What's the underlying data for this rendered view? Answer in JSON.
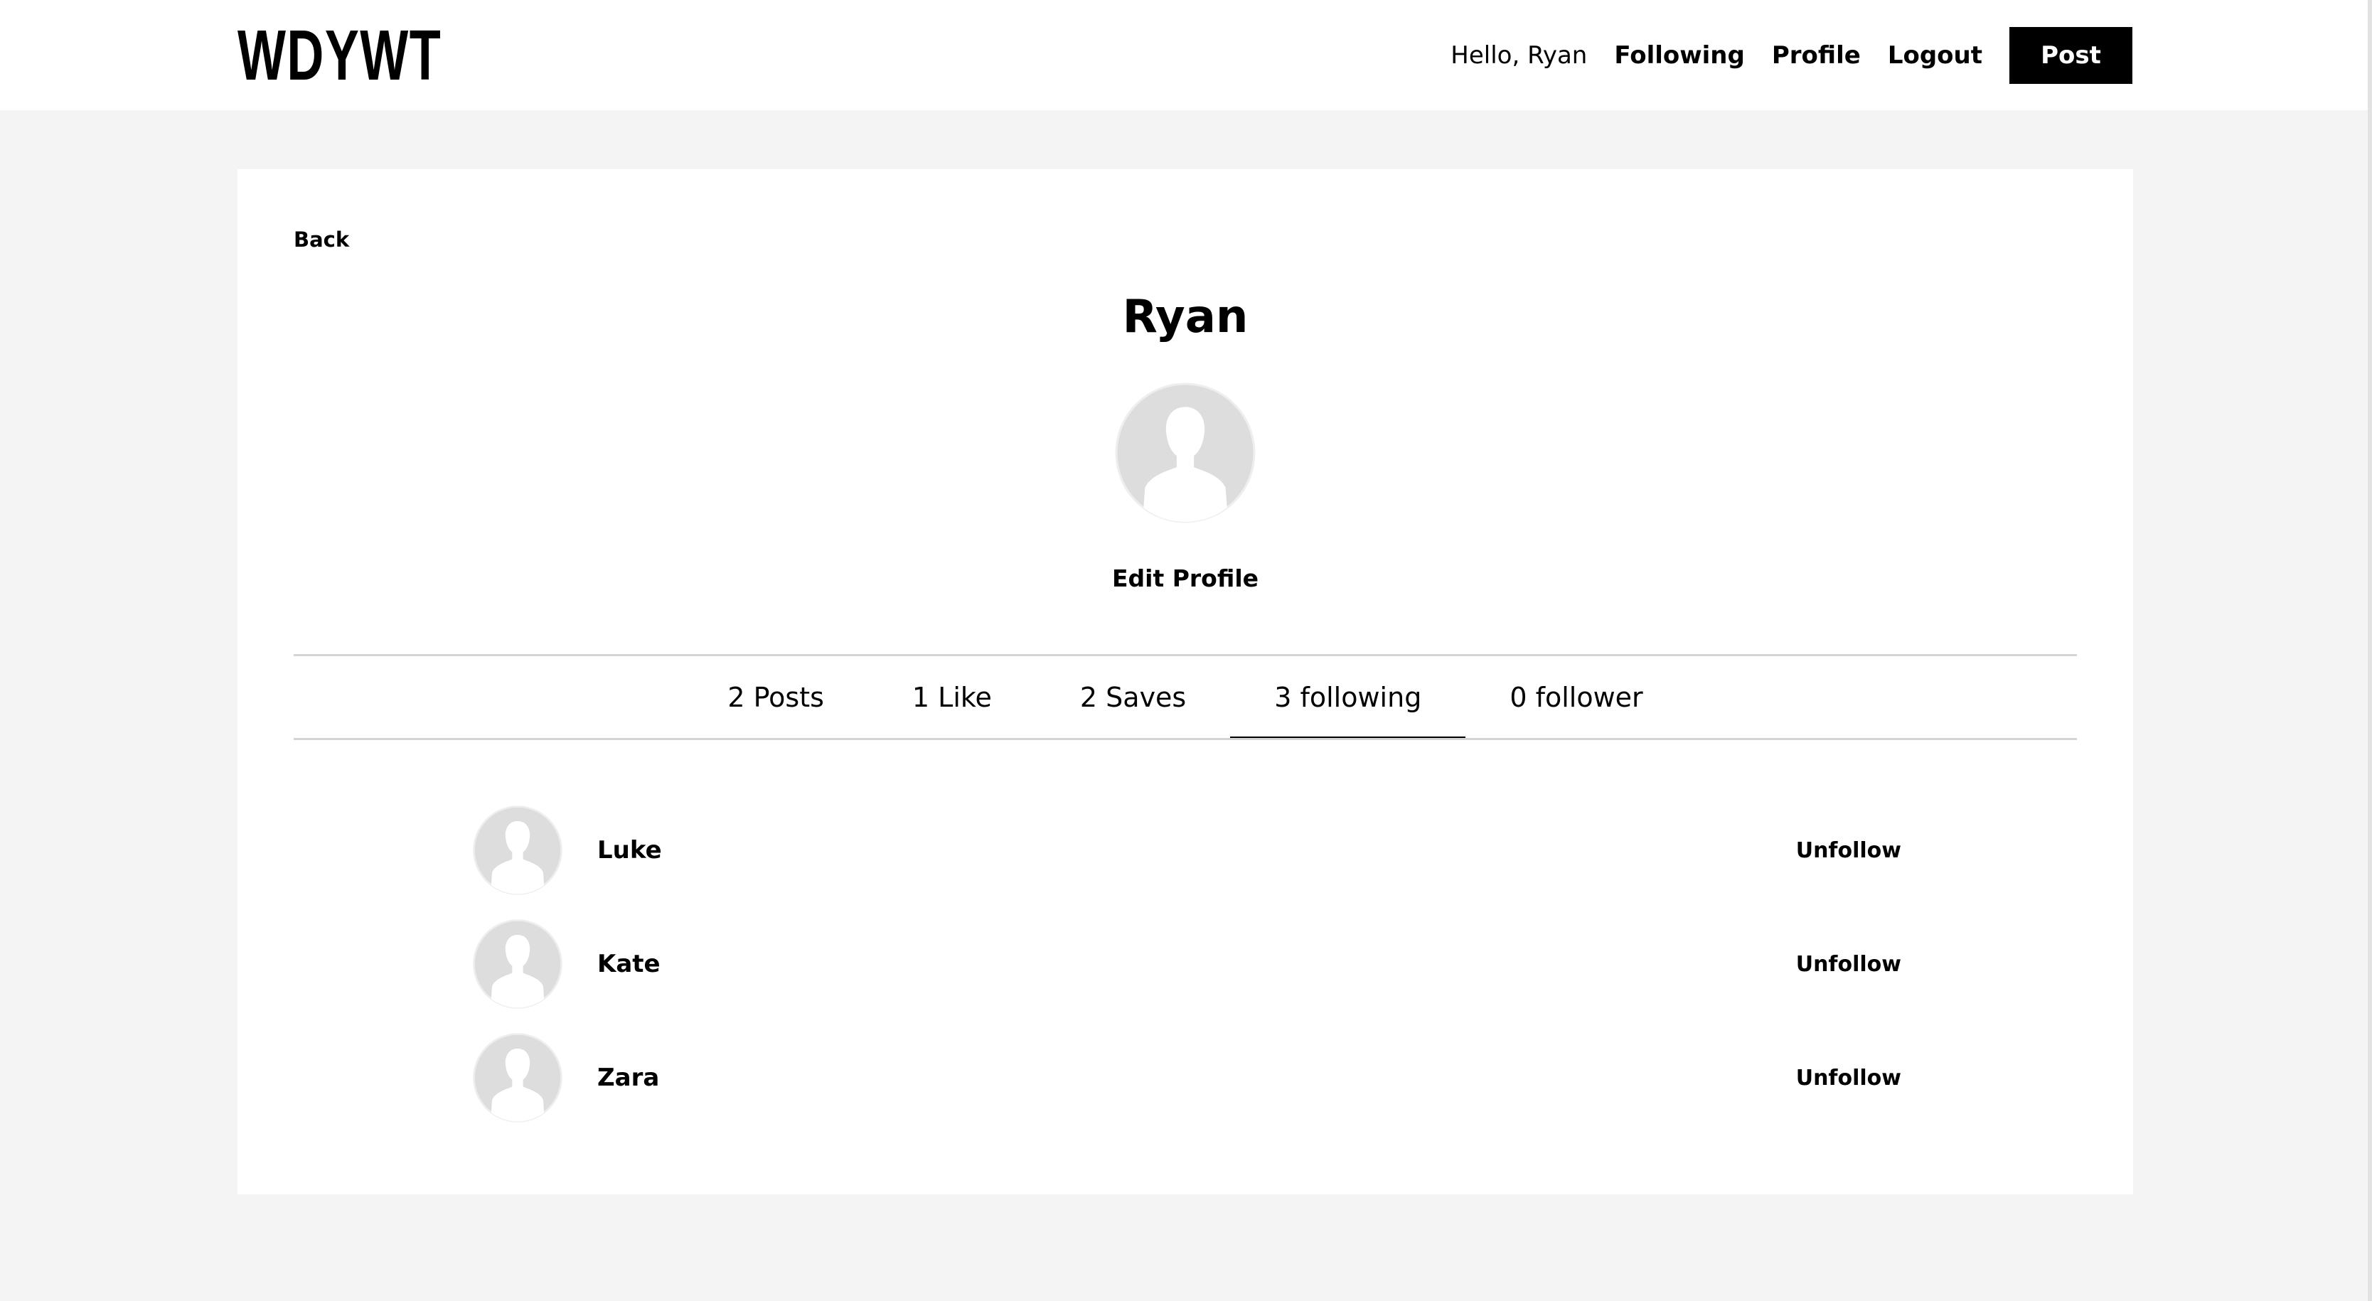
{
  "header": {
    "logo": "WDYWT",
    "greeting": "Hello, Ryan",
    "nav": {
      "following": "Following",
      "profile": "Profile",
      "logout": "Logout",
      "post": "Post"
    }
  },
  "profile": {
    "back": "Back",
    "name": "Ryan",
    "avatar_icon": "user-silhouette-icon",
    "edit": "Edit Profile"
  },
  "tabs": [
    {
      "label": "2 Posts",
      "active": false
    },
    {
      "label": "1 Like",
      "active": false
    },
    {
      "label": "2 Saves",
      "active": false
    },
    {
      "label": "3 following",
      "active": true
    },
    {
      "label": "0 follower",
      "active": false
    }
  ],
  "following": [
    {
      "name": "Luke",
      "action": "Unfollow"
    },
    {
      "name": "Kate",
      "action": "Unfollow"
    },
    {
      "name": "Zara",
      "action": "Unfollow"
    }
  ],
  "colors": {
    "background": "#f4f4f4",
    "card": "#ffffff",
    "accent": "#000000",
    "divider": "#d4d4d4",
    "avatar_fill": "#dddddd"
  }
}
